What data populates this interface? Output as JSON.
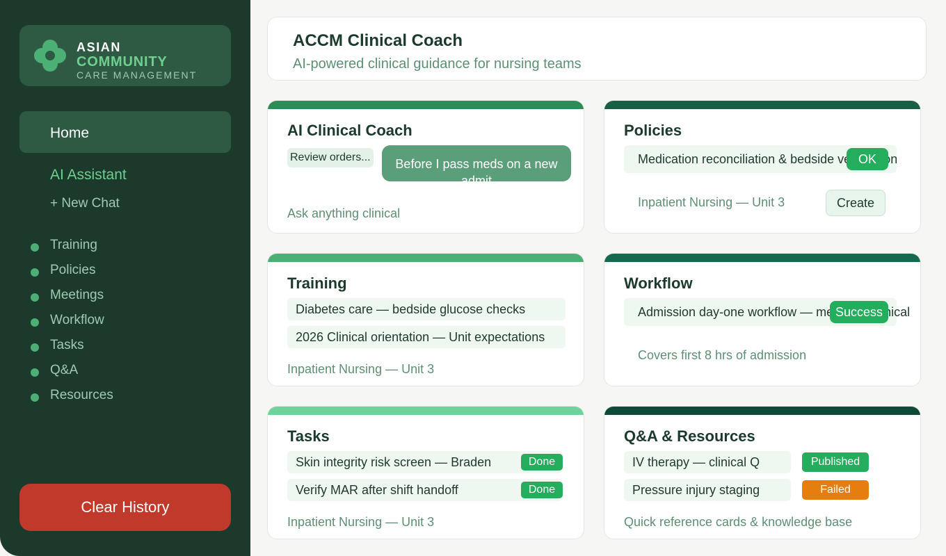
{
  "brand": {
    "line1": "ASIAN",
    "line2": "COMMUNITY",
    "line3": "CARE MANAGEMENT",
    "logo_icon": "flower-logo-icon"
  },
  "nav": {
    "home": "Home",
    "ai_assistant": "AI Assistant",
    "new_chat": "+ New Chat",
    "items": [
      "Training",
      "Policies",
      "Meetings",
      "Workflow",
      "Tasks",
      "Q&A",
      "Resources"
    ]
  },
  "clear_history": "Clear History",
  "header": {
    "title": "ACCM Clinical Coach",
    "subtitle": "AI-powered clinical guidance for nursing teams"
  },
  "cards": {
    "coach": {
      "title": "AI Clinical Coach",
      "chip": "Review orders...",
      "message": "Before I pass meds on a new admit",
      "footer": "Ask anything clinical",
      "bar_color": "#2e8b57"
    },
    "policies": {
      "title": "Policies",
      "item": "Medication reconciliation & bedside verification",
      "ok_badge": "OK",
      "footer": "Inpatient Nursing — Unit 3",
      "create_label": "Create",
      "bar_color": "#1a5e45"
    },
    "training": {
      "title": "Training",
      "items": [
        "Diabetes care — bedside glucose checks",
        "2026 Clinical orientation — Unit expectations"
      ],
      "footer": "Inpatient Nursing — Unit 3",
      "bar_color": "#4caf73"
    },
    "workflow": {
      "title": "Workflow",
      "item": "Admission day-one workflow — med-surg clinical",
      "success_badge": "Success",
      "footer": "Covers first 8 hrs of admission",
      "bar_color": "#15694f"
    },
    "tasks": {
      "title": "Tasks",
      "items": [
        {
          "label": "Skin integrity risk screen — Braden",
          "status": "Done"
        },
        {
          "label": "Verify MAR after shift handoff",
          "status": "Done"
        }
      ],
      "footer": "Inpatient Nursing — Unit 3",
      "bar_color": "#72d19a"
    },
    "qa": {
      "title": "Q&A & Resources",
      "items": [
        {
          "label": "IV therapy — clinical Q",
          "status": "Published"
        },
        {
          "label": "Pressure injury staging",
          "status": "Failed"
        }
      ],
      "footer": "Quick reference cards & knowledge base",
      "bar_color": "#0f4a38"
    }
  },
  "colors": {
    "sidebar": "#1c3a2c",
    "accent": "#4caf73",
    "success": "#23ad5c",
    "warning": "#e67e0f",
    "danger": "#c0392b"
  }
}
